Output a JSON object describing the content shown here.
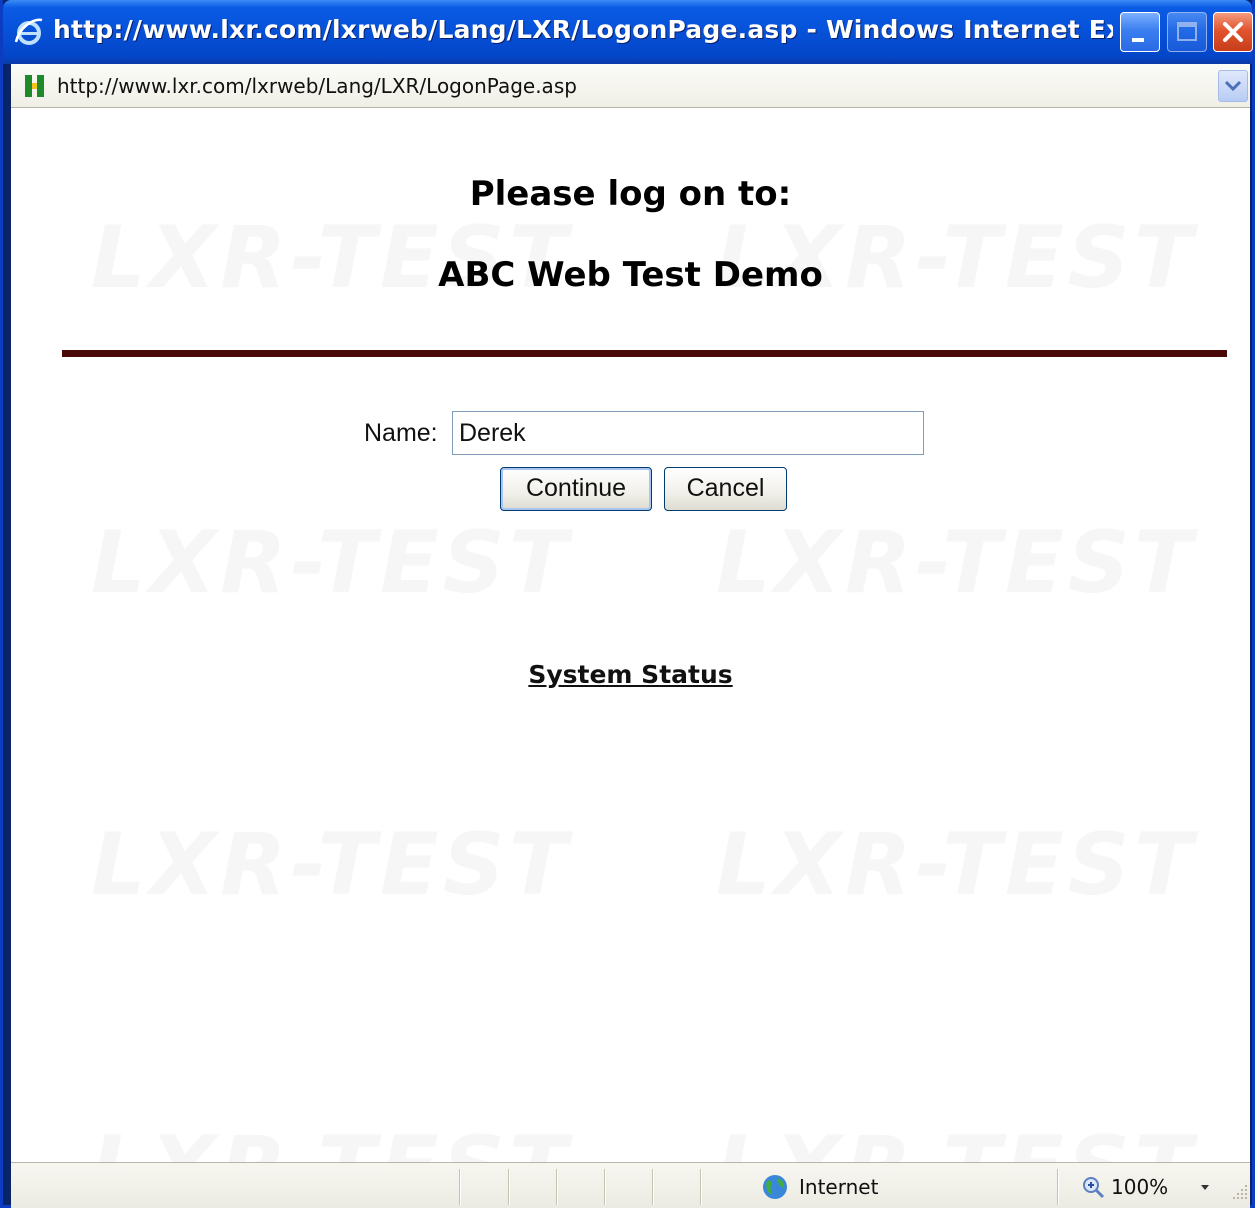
{
  "window": {
    "title": "http://www.lxr.com/lxrweb/Lang/LXR/LogonPage.asp - Windows Internet Explorer ...",
    "app_icon": "ie-icon"
  },
  "addressbar": {
    "url": "http://www.lxr.com/lxrweb/Lang/LXR/LogonPage.asp",
    "site_icon": "site-favicon-icon"
  },
  "page": {
    "heading_line1": "Please log on to:",
    "heading_line2": "ABC Web Test Demo",
    "watermark": "LXR-TEST",
    "name_label": "Name:",
    "name_value": "Derek",
    "continue_label": "Continue",
    "cancel_label": "Cancel",
    "status_link": "System Status"
  },
  "statusbar": {
    "zone": "Internet",
    "zoom": "100%"
  },
  "colors": {
    "desktop": "#6d0a0a",
    "titlebar": "#0651d8",
    "rule": "#4a0808",
    "close": "#e2542e"
  }
}
